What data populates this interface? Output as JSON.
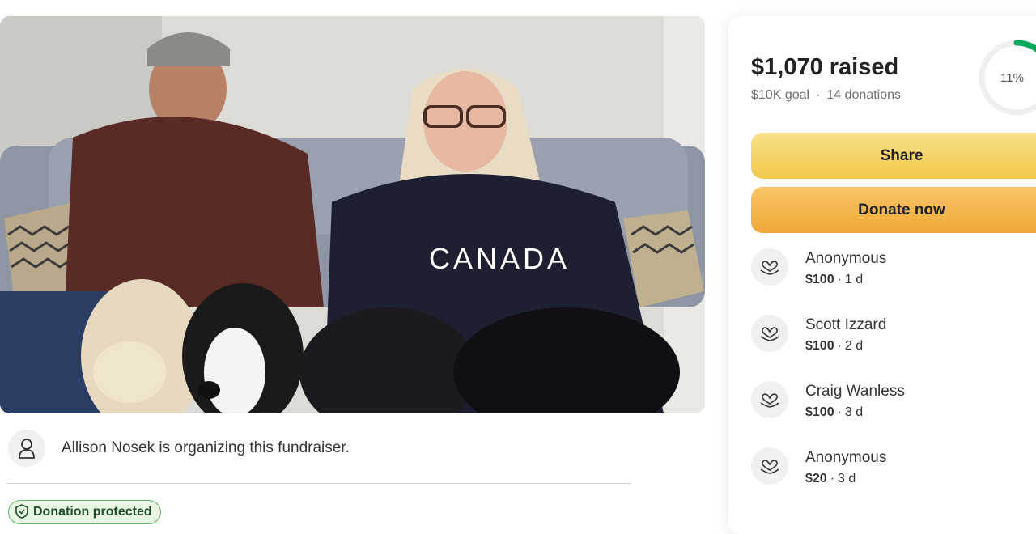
{
  "photo": {
    "shirt_text": "CANADA"
  },
  "organizer": {
    "text": "Allison Nosek is organizing this fundraiser."
  },
  "protection": {
    "label": "Donation protected"
  },
  "summary": {
    "raised": "$1,070 raised",
    "goal": "$10K goal",
    "donations": "14 donations",
    "progress_label": "11%",
    "progress_fraction": 0.11
  },
  "buttons": {
    "share": "Share",
    "donate": "Donate now"
  },
  "donations": [
    {
      "name": "Anonymous",
      "amount": "$100",
      "time": "1 d"
    },
    {
      "name": "Scott Izzard",
      "amount": "$100",
      "time": "2 d"
    },
    {
      "name": "Craig Wanless",
      "amount": "$100",
      "time": "3 d"
    },
    {
      "name": "Anonymous",
      "amount": "$20",
      "time": "3 d"
    }
  ],
  "colors": {
    "accent_green": "#02a95c",
    "share_yellow": "#f2c94c",
    "donate_orange": "#f0a83a",
    "protected_green": "#5fb86a"
  },
  "icons": {
    "organizer": "person-icon",
    "donor": "heart-hand-icon",
    "protected": "shield-icon"
  }
}
